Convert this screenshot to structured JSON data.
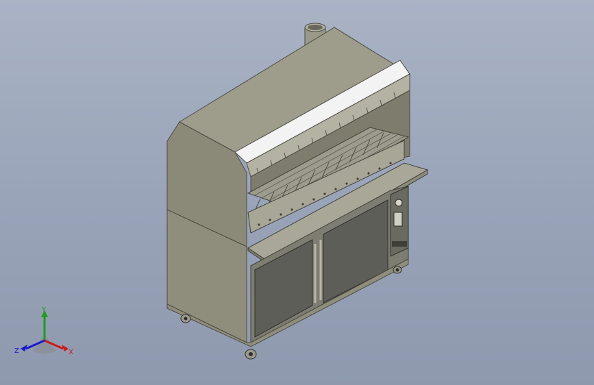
{
  "viewport": {
    "background_top": "#a9b3c4",
    "background_bottom": "#8e99ae"
  },
  "model": {
    "body_color": "#8f8e7c",
    "body_shadow": "#6f6e60",
    "door_color": "#5f5f5a",
    "hood_stripe": "#f2f2f2",
    "grill_color": "#9a9a8c"
  },
  "triad": {
    "x_label": "X",
    "y_label": "Y",
    "z_label": "Z",
    "x_color": "#d01818",
    "y_color": "#18a018",
    "z_color": "#1818d0"
  }
}
